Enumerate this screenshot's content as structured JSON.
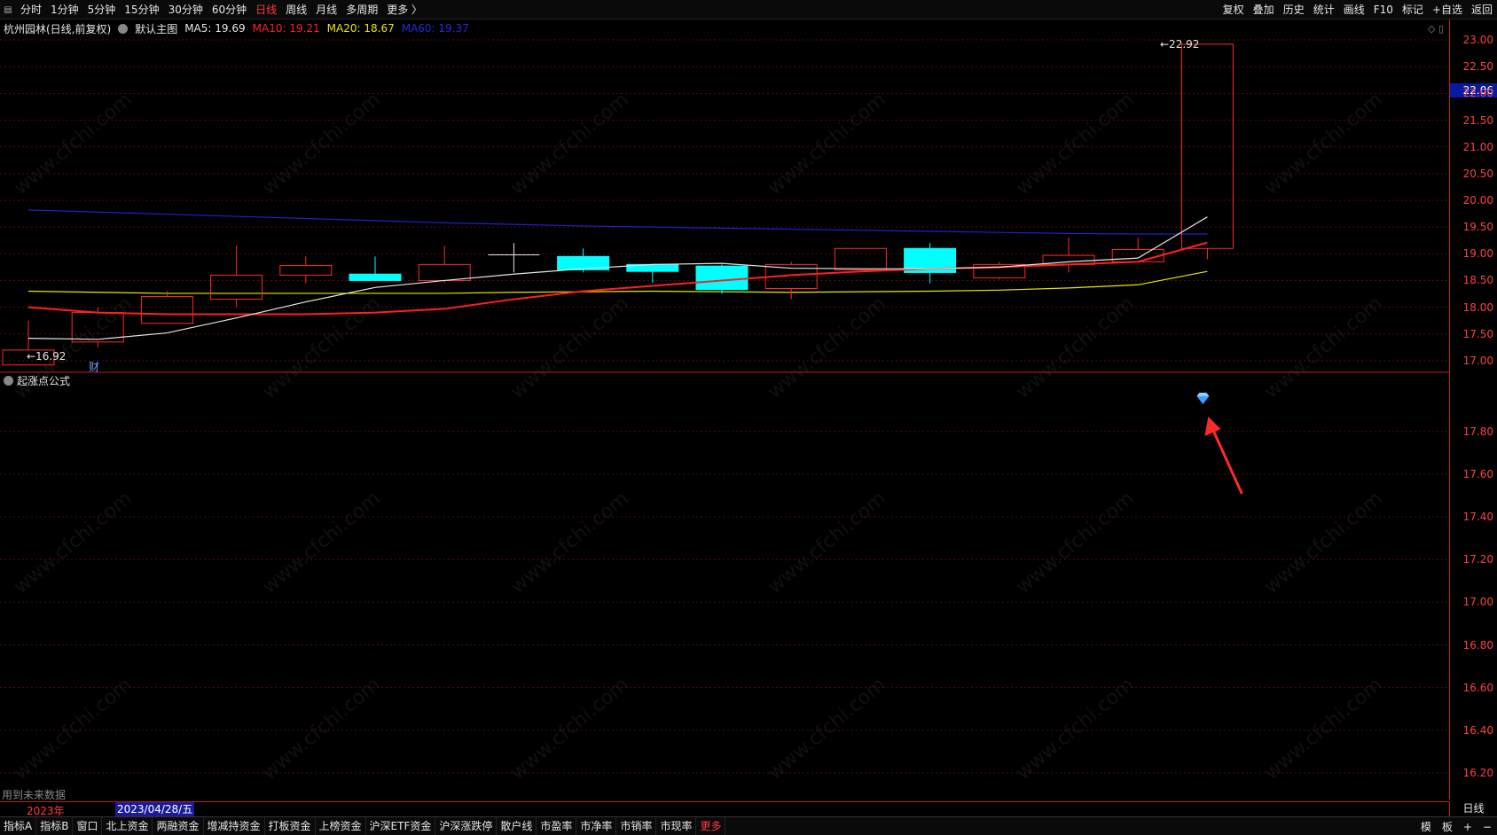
{
  "toolbar": {
    "periods": [
      "分时",
      "1分钟",
      "5分钟",
      "15分钟",
      "30分钟",
      "60分钟",
      "日线",
      "周线",
      "月线",
      "多周期",
      "更多 〉"
    ],
    "active_period": "日线",
    "right_items": [
      "复权",
      "叠加",
      "历史",
      "统计",
      "画线",
      "F10",
      "标记",
      "+自选",
      "返回"
    ]
  },
  "chart_info": {
    "title": "杭州园林(日线,前复权)",
    "main_chart": "默认主图",
    "ma5": "MA5: 19.69",
    "ma10": "MA10: 19.21",
    "ma20": "MA20: 18.67",
    "ma60": "MA60: 19.37"
  },
  "colors": {
    "ma5": "#e6e6e6",
    "ma10": "#ff2020",
    "ma20": "#e8e800",
    "ma60": "#2020c8",
    "up": "#ff2a2a",
    "down": "#00ffff",
    "axis": "#c01e1e"
  },
  "price_axis": {
    "ticks": [
      "23.00",
      "22.50",
      "22.00",
      "21.50",
      "21.00",
      "20.50",
      "20.00",
      "19.50",
      "19.00",
      "18.50",
      "18.00",
      "17.50",
      "17.00"
    ],
    "current_price": "22.06"
  },
  "indicator": {
    "name": "起涨点公式",
    "ticks": [
      "17.80",
      "17.60",
      "17.40",
      "17.20",
      "17.00",
      "16.80",
      "16.60",
      "16.40",
      "16.20"
    ]
  },
  "annotations": {
    "low_label": "←16.92",
    "high_label": "←22.92",
    "cai_label": "财",
    "future_data": "用到未来数据"
  },
  "date_bar": {
    "year": "2023年",
    "selected_date": "2023/04/28/五",
    "period_label": "日线"
  },
  "watermark": "www.cfchi.com",
  "bottom_tabs": [
    "指标A",
    "指标B",
    "窗口",
    "北上资金",
    "两融资金",
    "增减持资金",
    "打板资金",
    "上榜资金",
    "沪深ETF资金",
    "沪深涨跌停",
    "散户线",
    "市盈率",
    "市净率",
    "市销率",
    "市现率",
    "更多"
  ],
  "active_bottom_tab": "更多",
  "bottom_right": [
    "模",
    "板",
    "+",
    "−"
  ],
  "chart_data": {
    "type": "candlestick",
    "y_range": [
      16.8,
      23.1
    ],
    "candles": [
      {
        "o": 16.92,
        "c": 17.2,
        "h": 17.75,
        "l": 16.92
      },
      {
        "o": 17.35,
        "c": 17.9,
        "h": 18.0,
        "l": 17.25
      },
      {
        "o": 17.7,
        "c": 18.2,
        "h": 18.3,
        "l": 17.7
      },
      {
        "o": 18.15,
        "c": 18.6,
        "h": 19.15,
        "l": 18.0
      },
      {
        "o": 18.6,
        "c": 18.78,
        "h": 18.95,
        "l": 18.45
      },
      {
        "o": 18.62,
        "c": 18.5,
        "h": 18.95,
        "l": 18.5
      },
      {
        "o": 18.5,
        "c": 18.8,
        "h": 19.15,
        "l": 18.45
      },
      {
        "o": 18.98,
        "c": 18.98,
        "h": 19.2,
        "l": 18.65
      },
      {
        "o": 18.95,
        "c": 18.7,
        "h": 19.1,
        "l": 18.65
      },
      {
        "o": 18.8,
        "c": 18.67,
        "h": 18.8,
        "l": 18.45
      },
      {
        "o": 18.77,
        "c": 18.33,
        "h": 18.8,
        "l": 18.25
      },
      {
        "o": 18.35,
        "c": 18.8,
        "h": 18.85,
        "l": 18.15
      },
      {
        "o": 18.7,
        "c": 19.1,
        "h": 19.1,
        "l": 18.7
      },
      {
        "o": 19.1,
        "c": 18.65,
        "h": 19.2,
        "l": 18.45
      },
      {
        "o": 18.55,
        "c": 18.8,
        "h": 18.85,
        "l": 18.52
      },
      {
        "o": 18.8,
        "c": 18.97,
        "h": 19.3,
        "l": 18.65
      },
      {
        "o": 18.85,
        "c": 19.08,
        "h": 19.3,
        "l": 18.85
      },
      {
        "o": 19.1,
        "c": 22.92,
        "h": 22.92,
        "l": 18.9
      }
    ],
    "ma5": [
      17.42,
      17.4,
      17.52,
      17.8,
      18.1,
      18.37,
      18.5,
      18.62,
      18.72,
      18.8,
      18.82,
      18.73,
      18.72,
      18.72,
      18.75,
      18.85,
      18.92,
      19.69
    ],
    "ma10": [
      18.0,
      17.9,
      17.87,
      17.87,
      17.87,
      17.9,
      17.97,
      18.15,
      18.3,
      18.4,
      18.5,
      18.6,
      18.67,
      18.72,
      18.75,
      18.8,
      18.85,
      19.21
    ],
    "ma20": [
      18.3,
      18.28,
      18.26,
      18.26,
      18.26,
      18.26,
      18.26,
      18.28,
      18.29,
      18.3,
      18.29,
      18.28,
      18.29,
      18.3,
      18.32,
      18.36,
      18.42,
      18.67
    ],
    "ma60": [
      19.82,
      19.78,
      19.74,
      19.7,
      19.66,
      19.62,
      19.58,
      19.55,
      19.52,
      19.5,
      19.48,
      19.46,
      19.44,
      19.42,
      19.4,
      19.38,
      19.37,
      19.37
    ],
    "indicator_signal_index": 17
  }
}
